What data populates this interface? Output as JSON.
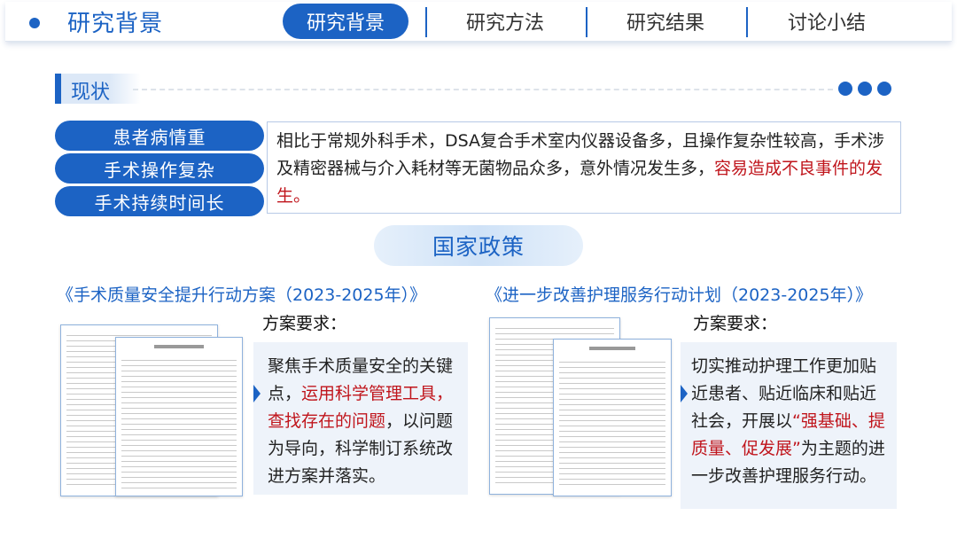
{
  "header": {
    "title": "研究背景",
    "nav": [
      "研究背景",
      "研究方法",
      "研究结果",
      "讨论小结"
    ],
    "active_index": 0
  },
  "status_section": {
    "title": "现状",
    "pills": [
      "患者病情重",
      "手术操作复杂",
      "手术持续时间长"
    ],
    "text_main": "相比于常规外科手术，DSA复合手术室内仪器设备多，且操作复杂性较高，手术涉及精密器械与介入耗材等无菌物品众多，意外情况发生多，",
    "text_highlight": "容易造成不良事件的发生。"
  },
  "policy_section": {
    "title": "国家政策",
    "docs": [
      {
        "title": "《手术质量安全提升行动方案（2023-2025年）》",
        "req_label": "方案要求：",
        "req_parts": [
          {
            "text": "聚焦手术质量安全的关键点，",
            "highlight": false
          },
          {
            "text": "运用科学管理工具，查找存在的问题",
            "highlight": true
          },
          {
            "text": "，以问题为导向，科学制订系统改进方案并落实。",
            "highlight": false
          }
        ]
      },
      {
        "title": "《进一步改善护理服务行动计划（2023-2025年）》",
        "req_label": "方案要求：",
        "req_parts": [
          {
            "text": "切实推动护理工作更加贴近患者、贴近临床和贴近社会，开展以",
            "highlight": false
          },
          {
            "text": "“强基础、提质量、促发展”",
            "highlight": true
          },
          {
            "text": "为主题的进一步改善护理服务行动。",
            "highlight": false
          }
        ]
      }
    ]
  },
  "colors": {
    "primary": "#1c63c4",
    "highlight": "#c0151c",
    "panel": "#eef3fa"
  }
}
